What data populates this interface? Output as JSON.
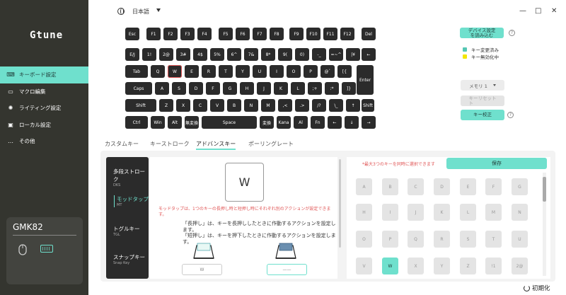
{
  "app": {
    "logo": "Gtune"
  },
  "sidebar": {
    "items": [
      {
        "label": "キーボード設定",
        "icon": "keyboard-icon",
        "active": true
      },
      {
        "label": "マクロ編集",
        "icon": "macro-icon",
        "active": false
      },
      {
        "label": "ライティング設定",
        "icon": "lighting-icon",
        "active": false
      },
      {
        "label": "ローカル設定",
        "icon": "local-icon",
        "active": false
      },
      {
        "label": "その他",
        "icon": "more-icon",
        "active": false
      }
    ],
    "device": {
      "name": "GMK82"
    }
  },
  "topbar": {
    "language": "日本語",
    "minimize": "—",
    "maximize": "□",
    "close": "✕"
  },
  "keyboard": {
    "rows": [
      [
        "Esc",
        "F1",
        "F2",
        "F3",
        "F4",
        "F5",
        "F6",
        "F7",
        "F8",
        "F9",
        "F10",
        "F11",
        "F12",
        "Del"
      ],
      [
        "E/J",
        "1!",
        "2@",
        "3#",
        "4$",
        "5%",
        "6^",
        "7&",
        "8*",
        "9(",
        "0)",
        "-_",
        "=~^",
        "|¥",
        "←"
      ],
      [
        "Tab",
        "Q",
        "W",
        "E",
        "R",
        "T",
        "Y",
        "U",
        "I",
        "O",
        "P",
        "@`",
        "[{",
        "Enter"
      ],
      [
        "Caps",
        "A",
        "S",
        "D",
        "F",
        "G",
        "H",
        "J",
        "K",
        "L",
        ";+",
        ":*",
        "]}"
      ],
      [
        "Shift",
        "Z",
        "X",
        "C",
        "V",
        "B",
        "N",
        "M",
        ",<",
        ".>",
        "/?",
        "\\_",
        "↑",
        "Shift"
      ],
      [
        "Ctrl",
        "Win",
        "Alt",
        "無変換",
        "Space",
        "変換",
        "Kana",
        "Al",
        "Fn",
        "←",
        "↓",
        "→"
      ]
    ],
    "selected": "W"
  },
  "right_panel": {
    "read_device": "デバイス設定\nを読み込む",
    "legend": [
      {
        "label": "キー変更済み",
        "color": "#55c7b4"
      },
      {
        "label": "キー無効化中",
        "color": "#f2e600"
      }
    ],
    "memory": "メモリ 1",
    "key_reset": "キーリセット\nト",
    "key_calibrate": "キー校正"
  },
  "tabs": [
    {
      "label": "カスタムキー",
      "active": false
    },
    {
      "label": "キーストローク",
      "active": false
    },
    {
      "label": "アドバンスキー",
      "active": true
    },
    {
      "label": "ポーリングレート",
      "active": false
    }
  ],
  "modes": [
    {
      "title": "多段ストローク",
      "sub": "DKS",
      "active": false
    },
    {
      "title": "モッドタップ",
      "sub": "MT",
      "active": true
    },
    {
      "title": "トグルキー",
      "sub": "TGL",
      "active": false
    },
    {
      "title": "スナップキー",
      "sub": "Snap Key",
      "active": false
    }
  ],
  "detail": {
    "key": "W",
    "note": "モッドタップは、1つのキーの長押し時と短押し時にそれぞれ別のアクションが設定できます。",
    "desc1": "「長押し」は、キーを長押ししたときに作動するアクションを設定します。",
    "desc2": "「短押し」は、キーを押下したときに作動するアクションを設定します。",
    "field_hold": "W",
    "field_tap": "——"
  },
  "picker": {
    "note": "*最大3つのキーを同時に選択できます",
    "save": "保存",
    "rows": [
      [
        "A",
        "B",
        "C",
        "D",
        "E",
        "F",
        "G"
      ],
      [
        "H",
        "I",
        "J",
        "K",
        "L",
        "M",
        "N"
      ],
      [
        "O",
        "P",
        "Q",
        "R",
        "S",
        "T",
        "U"
      ],
      [
        "V",
        "W",
        "X",
        "Y",
        "Z",
        "!1",
        "2@"
      ]
    ],
    "selected": "W"
  },
  "footer": {
    "reset": "初期化"
  },
  "colors": {
    "accent": "#6fe0cd",
    "sidebar": "#34352f",
    "key": "#2b2b2b",
    "alert": "#e05555"
  }
}
